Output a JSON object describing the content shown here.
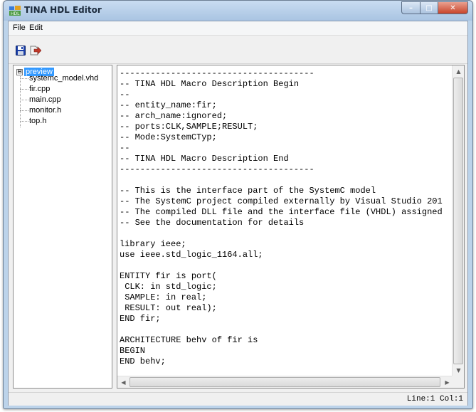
{
  "window": {
    "title": "TINA HDL Editor",
    "controls": {
      "minimize": "–",
      "maximize": "□",
      "close": "✕"
    }
  },
  "menu": [
    "File",
    "Edit"
  ],
  "toolbar": {
    "buttons": [
      {
        "name": "save-icon",
        "color": "#1a3fa8"
      },
      {
        "name": "export-icon",
        "color": "#c0392b"
      }
    ]
  },
  "tree": {
    "toggle": "⊟",
    "root": "preview",
    "children": [
      "systemc_model.vhd",
      "fir.cpp",
      "main.cpp",
      "monitor.h",
      "top.h"
    ]
  },
  "editor": {
    "lines": [
      "--------------------------------------",
      "-- TINA HDL Macro Description Begin",
      "--",
      "-- entity_name:fir;",
      "-- arch_name:ignored;",
      "-- ports:CLK,SAMPLE;RESULT;",
      "-- Mode:SystemCTyp;",
      "--",
      "-- TINA HDL Macro Description End",
      "--------------------------------------",
      "",
      "-- This is the interface part of the SystemC model",
      "-- The SystemC project compiled externally by Visual Studio 201",
      "-- The compiled DLL file and the interface file (VHDL) assigned",
      "-- See the documentation for details",
      "",
      "library ieee;",
      "use ieee.std_logic_1164.all;",
      "",
      "ENTITY fir is port(",
      " CLK: in std_logic;",
      " SAMPLE: in real;",
      " RESULT: out real);",
      "END fir;",
      "",
      "ARCHITECTURE behv of fir is",
      "BEGIN",
      "END behv;"
    ]
  },
  "statusbar": {
    "position": "Line:1 Col:1"
  }
}
